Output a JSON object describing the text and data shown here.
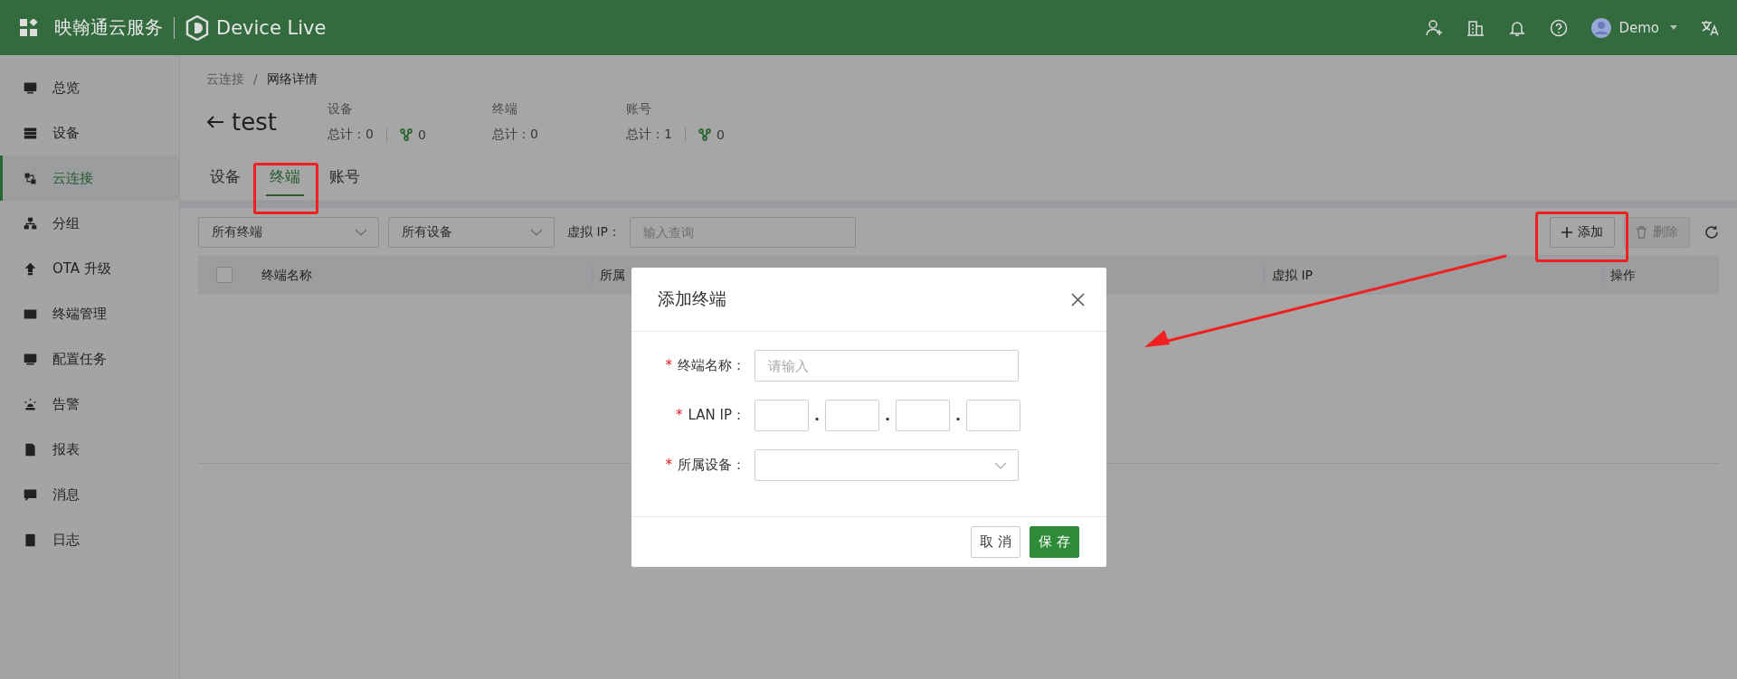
{
  "header": {
    "brand": "映翰通云服务",
    "product": "Device Live",
    "user": "Demo"
  },
  "sidebar": {
    "items": [
      {
        "label": "总览",
        "selected": false
      },
      {
        "label": "设备",
        "selected": false
      },
      {
        "label": "云连接",
        "selected": true
      },
      {
        "label": "分组",
        "selected": false
      },
      {
        "label": "OTA 升级",
        "selected": false
      },
      {
        "label": "终端管理",
        "selected": false
      },
      {
        "label": "配置任务",
        "selected": false
      },
      {
        "label": "告警",
        "selected": false
      },
      {
        "label": "报表",
        "selected": false
      },
      {
        "label": "消息",
        "selected": false
      },
      {
        "label": "日志",
        "selected": false
      }
    ]
  },
  "breadcrumb": {
    "parent": "云连接",
    "separator": "/",
    "current": "网络详情"
  },
  "page_title": "test",
  "stats": [
    {
      "title": "设备",
      "total": "总计：0",
      "online": "0"
    },
    {
      "title": "终端",
      "total": "总计：0"
    },
    {
      "title": "账号",
      "total": "总计：1",
      "online": "0"
    }
  ],
  "tabs": [
    {
      "label": "设备",
      "selected": false
    },
    {
      "label": "终端",
      "selected": true
    },
    {
      "label": "账号",
      "selected": false
    }
  ],
  "filters": {
    "terminal_select": "所有终端",
    "device_select": "所有设备",
    "virtual_ip_label": "虚拟 IP：",
    "virtual_ip_placeholder": "输入查询"
  },
  "toolbar": {
    "add": "添加",
    "delete": "删除",
    "delete_disabled": true
  },
  "table": {
    "select_all_checked": false,
    "columns": [
      "终端名称",
      "所属",
      "虚拟 IP",
      "操作"
    ]
  },
  "dialog": {
    "title": "添加终端",
    "fields": [
      {
        "kind": "text",
        "required_mark": "*",
        "label": "终端名称：",
        "placeholder": "请输入"
      },
      {
        "kind": "ip",
        "required_mark": "*",
        "label": "LAN IP：",
        "separators": [
          ".",
          ".",
          "."
        ]
      },
      {
        "kind": "select",
        "required_mark": "*",
        "label": "所属设备："
      }
    ],
    "buttons": [
      {
        "label": "取 消",
        "kind": "default"
      },
      {
        "label": "保 存",
        "kind": "primary"
      }
    ]
  }
}
